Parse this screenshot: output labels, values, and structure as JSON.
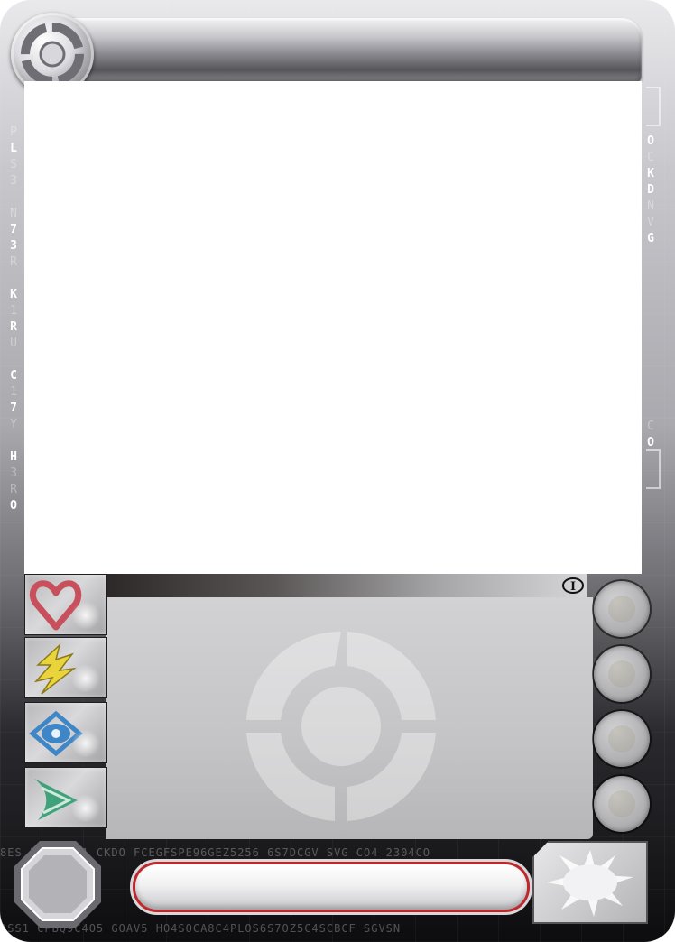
{
  "card": {
    "name": "",
    "type_line": "",
    "rules_text": "",
    "rarity_symbol": "I"
  },
  "codes": {
    "left": [
      "P",
      "L",
      "S",
      "3",
      "N",
      "7",
      "3",
      "R",
      "K",
      "1",
      "R",
      "U",
      "C",
      "1",
      "7",
      "Y",
      "H",
      "3",
      "R",
      "O"
    ],
    "right_top": [
      "O",
      "C",
      "K",
      "D",
      "N",
      "V",
      "G"
    ],
    "right_bottom": [
      "C",
      "O"
    ],
    "bottom_line": "8ES EY SQ2S1  CKDO FCEGFSPE96GEZ5256 6S7DCGV SVG CO4 2304CO",
    "bottom_line2": "ASS1  CPBQ9C4O5 GOAV5 HO4SOCA8C4PLOS6S7OZ5C4SCBCF SGVSN"
  },
  "stats": [
    {
      "icon": "heart-icon",
      "color": "#c8505c"
    },
    {
      "icon": "lightning-icon",
      "color": "#e9d43b"
    },
    {
      "icon": "eye-icon",
      "color": "#3f86c6"
    },
    {
      "icon": "swoosh-icon",
      "color": "#3fa27a"
    }
  ],
  "orbs": [
    {
      "icon": "fist-icon"
    },
    {
      "icon": "hand-icon"
    },
    {
      "icon": "leaf-icon"
    },
    {
      "icon": "swirl-icon"
    }
  ],
  "colors": {
    "accent_red": "#c0272d",
    "frame_dark": "#0d0d10",
    "frame_light": "#e9e9ec"
  }
}
